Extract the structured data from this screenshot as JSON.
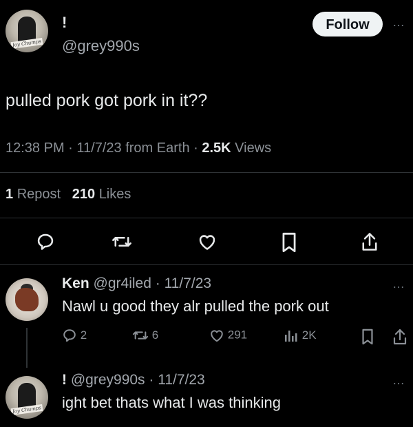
{
  "main_tweet": {
    "display_name": "!",
    "handle": "@grey990s",
    "follow_label": "Follow",
    "more_label": "…",
    "avatar_tag": "Joy Chumps",
    "text": "pulled pork got pork in it??",
    "time": "12:38 PM",
    "date": "11/7/23",
    "source": "from Earth",
    "views_count": "2.5K",
    "views_label": "Views",
    "reposts_count": "1",
    "reposts_label": "Repost",
    "likes_count": "210",
    "likes_label": "Likes"
  },
  "reply1": {
    "name": "Ken",
    "handle": "@gr4iled",
    "date": "11/7/23",
    "text": "Nawl u good they alr pulled the pork out",
    "replies": "2",
    "reposts": "6",
    "likes": "291",
    "views": "2K",
    "more_label": "…"
  },
  "reply2": {
    "name": "!",
    "handle": "@grey990s",
    "date": "11/7/23",
    "text": "ight bet thats what I was thinking",
    "avatar_tag": "Joy Chumps",
    "more_label": "…"
  },
  "icons": [
    "reply-icon",
    "repost-icon",
    "like-icon",
    "bookmark-icon",
    "share-icon",
    "views-icon"
  ]
}
